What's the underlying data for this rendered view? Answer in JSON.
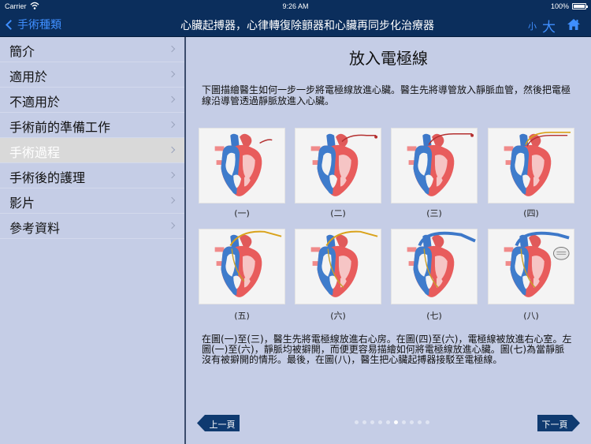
{
  "status": {
    "carrier": "Carrier",
    "time": "9:26 AM",
    "battery": "100%"
  },
  "nav": {
    "back_label": "手術種類",
    "title": "心臟起搏器，心律轉復除顫器和心臟再同步化治療器",
    "font_small": "小",
    "font_large": "大"
  },
  "sidebar": {
    "items": [
      {
        "label": "簡介"
      },
      {
        "label": "適用於"
      },
      {
        "label": "不適用於"
      },
      {
        "label": "手術前的準備工作"
      },
      {
        "label": "手術過程",
        "selected": true
      },
      {
        "label": "手術後的護理"
      },
      {
        "label": "影片"
      },
      {
        "label": "參考資料"
      }
    ]
  },
  "main": {
    "title": "放入電極線",
    "intro": "下圖描繪醫生如何一步一步將電極線放進心臟。醫生先將導管放入靜脈血管，然後把電極線沿導管透過靜脈放進入心臟。",
    "figures": [
      {
        "caption": "(一)"
      },
      {
        "caption": "(二)"
      },
      {
        "caption": "(三)"
      },
      {
        "caption": "(四)"
      },
      {
        "caption": "(五)"
      },
      {
        "caption": "(六)"
      },
      {
        "caption": "(七)"
      },
      {
        "caption": "(八)"
      }
    ],
    "description": "在圖(一)至(三)，醫生先將電極線放進右心房。在圖(四)至(六)，電極線被放進右心室。左圖(一)至(六)，靜脈均被擗開，而便更容易描繪如何將電極線放進心臟。圖(七)為當靜脈沒有被擗開的情形。最後，在圖(八)，醫生把心臟起搏器接駁至電極線。",
    "prev_label": "上一頁",
    "next_label": "下一頁",
    "pager": {
      "total": 10,
      "current": 6
    }
  },
  "colors": {
    "nav_bg": "#0b2e5c",
    "accent": "#3f8fff",
    "panel_bg": "#c5cde6",
    "button_bg": "#0f3a70"
  }
}
